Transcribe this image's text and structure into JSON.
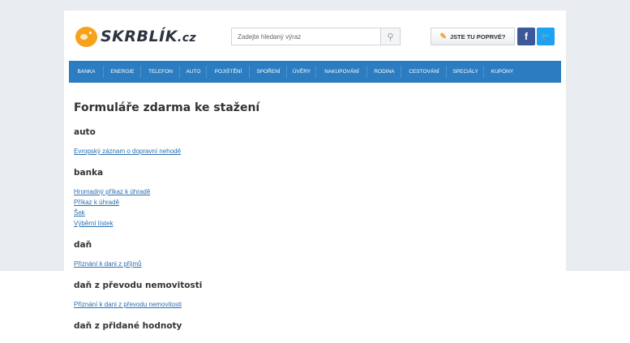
{
  "header": {
    "logo_text": "SKRBLÍK",
    "logo_tld": ".cz",
    "search": {
      "placeholder": "Zadejte hledaný výraz"
    },
    "first_visit_label": "JSTE TU POPRVÉ?",
    "facebook_label": "f",
    "twitter_label": "🐦"
  },
  "nav": {
    "items": [
      "BANKA",
      "ENERGIE",
      "TELEFON",
      "AUTO",
      "POJIŠTĚNÍ",
      "SPOŘENÍ",
      "ÚVĚRY",
      "NAKUPOVÁNÍ",
      "RODINA",
      "CESTOVÁNÍ",
      "SPECIÁLY",
      "KUPÓNY"
    ]
  },
  "main": {
    "title": "Formuláře zdarma ke stažení",
    "sections": [
      {
        "title": "auto",
        "links": [
          "Evropský záznam o dopravní nehodě"
        ]
      },
      {
        "title": "banka",
        "links": [
          "Hromadný příkaz k úhradě",
          "Příkaz k úhradě",
          "Šek",
          "Výběrní lístek"
        ]
      },
      {
        "title": "daň",
        "links": [
          "Přiznání k dani z příjmů"
        ]
      },
      {
        "title": "daň z převodu nemovitosti",
        "links": [
          "Přiznání k dani z převodu nemovitosti"
        ]
      },
      {
        "title": "daň z přidané hodnoty",
        "links": []
      }
    ]
  },
  "colors": {
    "nav_bg": "#2b7cc0",
    "link": "#2a6fb0",
    "logo_accent": "#f7a21b",
    "facebook": "#3b5998",
    "twitter": "#1da1f2"
  }
}
